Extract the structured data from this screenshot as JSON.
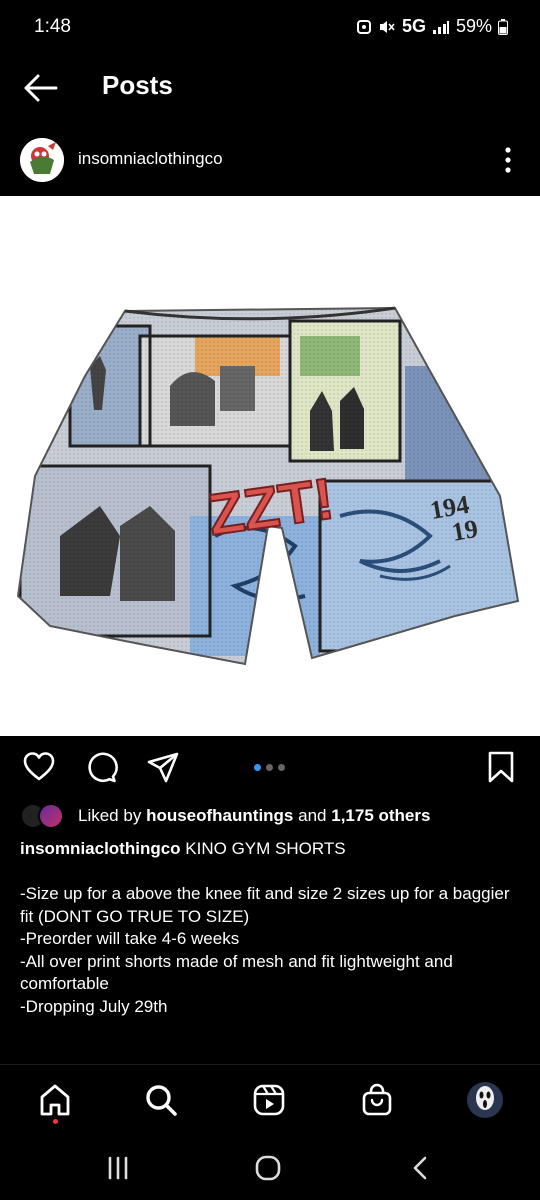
{
  "status_bar": {
    "time": "1:48",
    "network": "5G",
    "battery": "59%"
  },
  "header": {
    "title": "Posts",
    "back_icon": "arrow-left-icon"
  },
  "post": {
    "username": "insomniaclothingco",
    "more_icon": "more-vertical-icon",
    "image_alt": "Comic print mesh gym shorts",
    "pagination": {
      "count": 3,
      "active": 0
    },
    "likes": {
      "prefix": "Liked by",
      "user": "houseofhauntings",
      "connector": "and",
      "others": "1,175 others"
    },
    "caption_lines": [
      "KINO GYM SHORTS",
      "",
      "-Size up for a above the knee fit and size 2 sizes up for a baggier fit (DONT GO TRUE TO SIZE)",
      "-Preorder will take 4-6 weeks",
      "-All over print shorts made of mesh and fit lightweight and comfortable",
      "-Dropping July 29th"
    ],
    "print_text": {
      "sfx": "ZZT!",
      "year": "194",
      "year2": "19"
    }
  },
  "actions": [
    "heart-icon",
    "comment-icon",
    "share-icon",
    "bookmark-icon"
  ],
  "bottom_nav": [
    "home-icon",
    "search-icon",
    "reels-icon",
    "shop-icon",
    "profile-avatar"
  ],
  "system_nav": [
    "recents-icon",
    "home-circle-icon",
    "back-chevron-icon"
  ],
  "colors": {
    "accent": "#3897f0",
    "notification": "#ff3040",
    "background": "#000000"
  }
}
